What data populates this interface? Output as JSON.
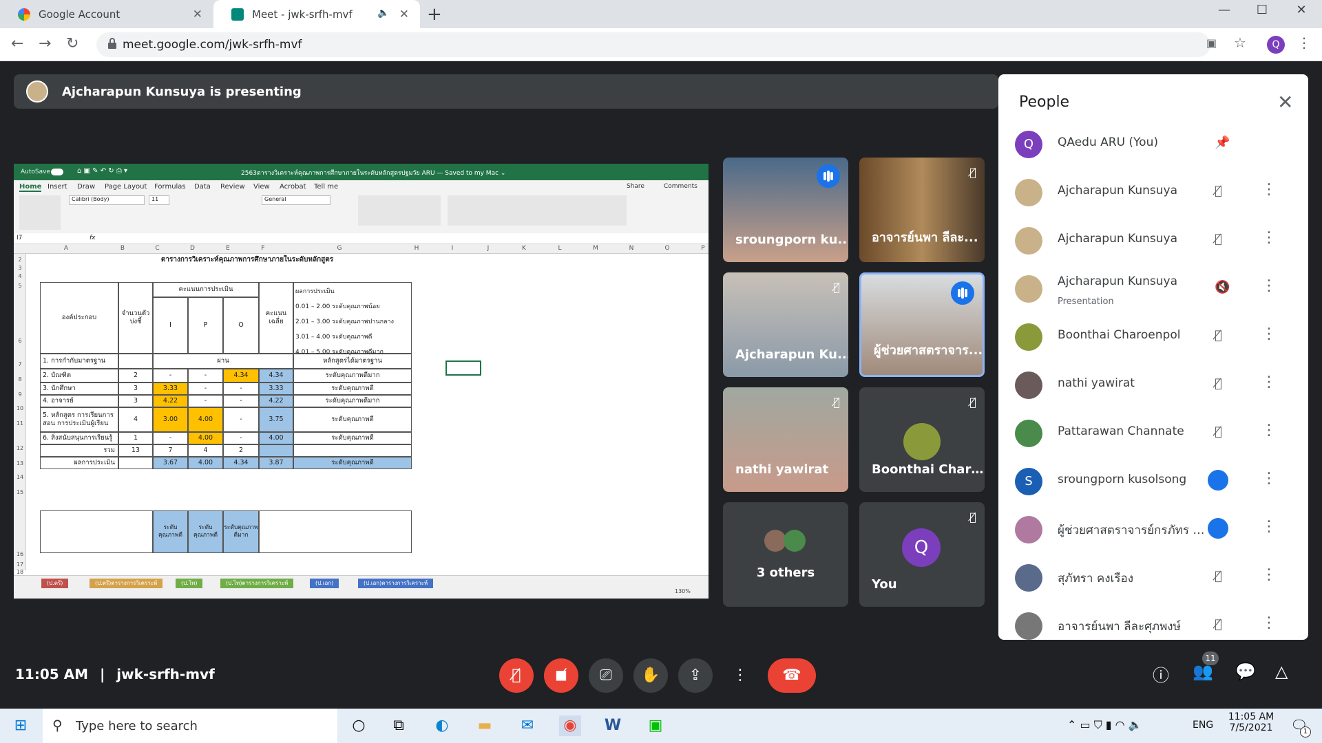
{
  "browser": {
    "tabs": [
      {
        "title": "Google Account"
      },
      {
        "title": "Meet - jwk-srfh-mvf"
      }
    ],
    "url": "meet.google.com/jwk-srfh-mvf",
    "profile_initial": "Q"
  },
  "meet": {
    "presenting": "Ajcharapun Kunsuya is presenting",
    "time": "11:05 AM",
    "meeting_code": "jwk-srfh-mvf",
    "participant_count": "11",
    "tiles": [
      {
        "name": "sroungporn ku...",
        "state": "speaking"
      },
      {
        "name": "อาจารย์นพา ลีละ...",
        "state": "muted"
      },
      {
        "name": "Ajcharapun Ku...",
        "state": "muted"
      },
      {
        "name": "ผู้ช่วยศาสตราจาร...",
        "state": "speaking"
      },
      {
        "name": "nathi yawirat",
        "state": "muted"
      },
      {
        "name": "Boonthai Charo...",
        "state": "muted"
      },
      {
        "name": "3 others",
        "state": ""
      },
      {
        "name": "You",
        "state": "muted",
        "initial": "Q"
      }
    ]
  },
  "people": {
    "title": "People",
    "list": [
      {
        "name": "QAedu ARU (You)",
        "sub": "",
        "initial": "Q",
        "color": "#7b3fbd",
        "action": "pin"
      },
      {
        "name": "Ajcharapun Kunsuya",
        "sub": "",
        "initial": "",
        "color": "#c9b28a",
        "action": "mic-off"
      },
      {
        "name": "Ajcharapun Kunsuya",
        "sub": "",
        "initial": "",
        "color": "#c9b28a",
        "action": "mic-off"
      },
      {
        "name": "Ajcharapun Kunsuya",
        "sub": "Presentation",
        "initial": "",
        "color": "#c9b28a",
        "action": "volume-off"
      },
      {
        "name": "Boonthai Charoenpol",
        "sub": "",
        "initial": "",
        "color": "#8a9a3a",
        "action": "mic-off"
      },
      {
        "name": "nathi yawirat",
        "sub": "",
        "initial": "",
        "color": "#6b5a5a",
        "action": "mic-off"
      },
      {
        "name": "Pattarawan Channate",
        "sub": "",
        "initial": "",
        "color": "#4a8a4a",
        "action": "mic-off"
      },
      {
        "name": "sroungporn kusolsong",
        "sub": "",
        "initial": "S",
        "color": "#1a5fb4",
        "action": "speaking"
      },
      {
        "name": "ผู้ช่วยศาสตราจารย์กรภัทร นิ...",
        "sub": "",
        "initial": "",
        "color": "#b07aa0",
        "action": "speaking"
      },
      {
        "name": "สุภัทรา คงเรือง",
        "sub": "",
        "initial": "",
        "color": "#5a6a8a",
        "action": "mic-off"
      },
      {
        "name": "อาจารย์นพา ลีละศุภพงษ์",
        "sub": "",
        "initial": "",
        "color": "#777777",
        "action": "mic-off"
      }
    ]
  },
  "excel": {
    "title": "2563ตารางวิเคราะห์คุณภาพการศึกษาภายในระดับหลักสูตรปฐมวัย ARU — Saved to my Mac ⌄",
    "autosave": "AutoSave",
    "ribbon_tabs": [
      "Home",
      "Insert",
      "Draw",
      "Page Layout",
      "Formulas",
      "Data",
      "Review",
      "View",
      "Acrobat",
      "Tell me"
    ],
    "share": "Share",
    "comments": "Comments",
    "font_name": "Calibri (Body)",
    "font_size": "11",
    "number_format": "General",
    "cell_ref": "I7",
    "columns": [
      "A",
      "B",
      "C",
      "D",
      "E",
      "F",
      "G",
      "H",
      "I",
      "J",
      "K",
      "L",
      "M",
      "N",
      "O",
      "P"
    ],
    "rows": [
      "2",
      "3",
      "4",
      "5",
      "6",
      "7",
      "8",
      "9",
      "10",
      "11",
      "12",
      "13",
      "14",
      "15",
      "16",
      "17",
      "18"
    ],
    "sheet_title": "ตารางการวิเคราะห์คุณภาพการศึกษาภายในระดับหลักสูตร",
    "h_component": "องค์ประกอบ",
    "h_count": "จำนวนตัวบ่งชี้",
    "h_score": "คะแนนการประเมิน",
    "h_i": "I",
    "h_p": "P",
    "h_o": "O",
    "h_avg": "คะแนนเฉลี่ย",
    "h_result": "ผลการประเมิน",
    "legend": [
      "0.01 – 2.00 ระดับคุณภาพน้อย",
      "2.01 – 3.00 ระดับคุณภาพปานกลาง",
      "3.01 – 4.00 ระดับคุณภาพดี",
      "4.01 – 5.00 ระดับคุณภาพดีมาก"
    ],
    "table": [
      {
        "name": "1. การกำกับมาตรฐาน",
        "n": "",
        "i": "ผ่าน",
        "p": "",
        "o": "",
        "avg": "",
        "res": "หลักสูตรได้มาตรฐาน"
      },
      {
        "name": "2. บัณฑิต",
        "n": "2",
        "i": "-",
        "p": "-",
        "o": "4.34",
        "avg": "4.34",
        "res": "ระดับคุณภาพดีมาก"
      },
      {
        "name": "3. นักศึกษา",
        "n": "3",
        "i": "3.33",
        "p": "-",
        "o": "-",
        "avg": "3.33",
        "res": "ระดับคุณภาพดี"
      },
      {
        "name": "4. อาจารย์",
        "n": "3",
        "i": "4.22",
        "p": "-",
        "o": "-",
        "avg": "4.22",
        "res": "ระดับคุณภาพดีมาก"
      },
      {
        "name": "5. หลักสูตร การเรียนการสอน การประเมินผู้เรียน",
        "n": "4",
        "i": "3.00",
        "p": "4.00",
        "o": "-",
        "avg": "3.75",
        "res": "ระดับคุณภาพดี"
      },
      {
        "name": "6. สิ่งสนับสนุนการเรียนรู้",
        "n": "1",
        "i": "-",
        "p": "4.00",
        "o": "-",
        "avg": "4.00",
        "res": "ระดับคุณภาพดี"
      },
      {
        "name": "รวม",
        "n": "13",
        "i": "7",
        "p": "4",
        "o": "2",
        "avg": "",
        "res": ""
      },
      {
        "name": "ผลการประเมิน",
        "n": "",
        "i": "3.67",
        "p": "4.00",
        "o": "4.34",
        "avg": "3.87",
        "res": "ระดับคุณภาพดี"
      }
    ],
    "levels": [
      "ระดับคุณภาพดี",
      "ระดับคุณภาพดี",
      "ระดับคุณภาพดีมาก"
    ],
    "sheet_tabs": [
      "(ป.ตรี)",
      "(ป.ตรี)ตารางการวิเคราะห์",
      "(ป.โท)",
      "(ป.โท)ตารางการวิเคราะห์",
      "(ป.เอก)",
      "(ป.เอก)ตารางการวิเคราะห์"
    ],
    "zoom": "130%"
  },
  "taskbar": {
    "search_placeholder": "Type here to search",
    "lang": "ENG",
    "time": "11:05 AM",
    "date": "7/5/2021",
    "notif": "1"
  }
}
